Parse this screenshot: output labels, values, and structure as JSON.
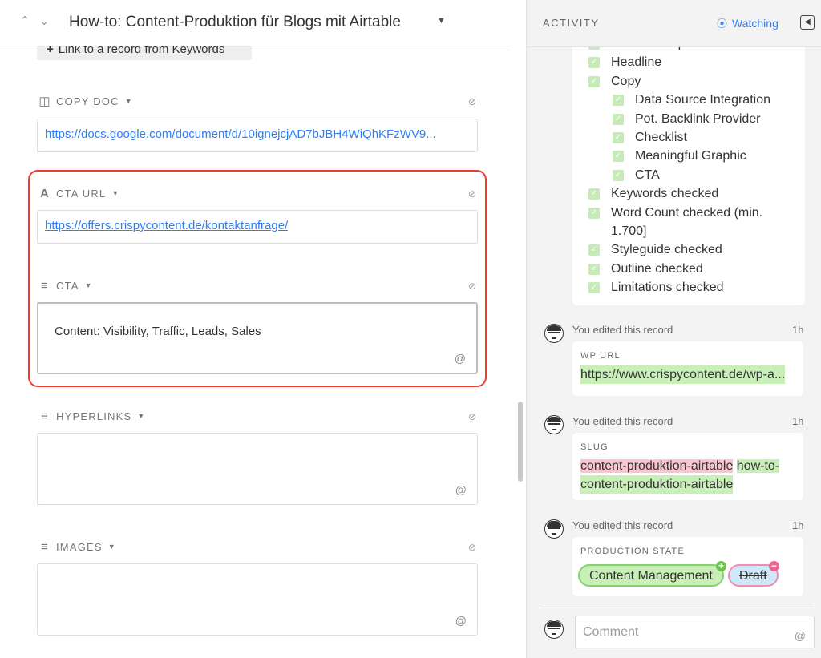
{
  "header": {
    "title": "How-to: Content-Produktion für Blogs mit Airtable",
    "prev_icon": "chevron-up-icon",
    "next_icon": "chevron-down-icon"
  },
  "link_button": {
    "label": "Link to a record from Keywords"
  },
  "fields": {
    "copy_doc": {
      "label": "COPY DOC",
      "value": "https://docs.google.com/document/d/10ignejcjAD7bJBH4WiQhKFzWV9..."
    },
    "cta_url": {
      "label": "CTA URL",
      "value": "https://offers.crispycontent.de/kontaktanfrage/"
    },
    "cta": {
      "label": "CTA",
      "value": "Content: Visibility, Traffic, Leads, Sales"
    },
    "hyperlinks": {
      "label": "HYPERLINKS",
      "value": ""
    },
    "images": {
      "label": "IMAGES",
      "value": ""
    }
  },
  "activity": {
    "title": "ACTIVITY",
    "watching_label": "Watching",
    "checklist": [
      {
        "label": "SEO Description",
        "indent": 0
      },
      {
        "label": "Headline",
        "indent": 0
      },
      {
        "label": "Copy",
        "indent": 0
      },
      {
        "label": "Data Source Integration",
        "indent": 1
      },
      {
        "label": "Pot. Backlink Provider",
        "indent": 1
      },
      {
        "label": "Checklist",
        "indent": 1
      },
      {
        "label": "Meaningful Graphic",
        "indent": 1
      },
      {
        "label": "CTA",
        "indent": 1
      },
      {
        "label": "Keywords checked",
        "indent": 0
      },
      {
        "label": "Word Count checked (min.",
        "indent": 0
      },
      {
        "label": "1.700]",
        "indent": 0,
        "continuation": true
      },
      {
        "label": "Styleguide checked",
        "indent": 0
      },
      {
        "label": "Outline checked",
        "indent": 0
      },
      {
        "label": "Limitations checked",
        "indent": 0
      }
    ],
    "edits": [
      {
        "meta": "You edited this record",
        "time": "1h",
        "field": "WP URL",
        "added": "https://www.crispycontent.de/wp-a..."
      },
      {
        "meta": "You edited this record",
        "time": "1h",
        "field": "SLUG",
        "removed": "content-produktion-airtable",
        "added_line1": "how-to-",
        "added_line2": "content-produktion-airtable"
      },
      {
        "meta": "You edited this record",
        "time": "1h",
        "field": "PRODUCTION STATE",
        "added_pill": "Content Management",
        "removed_pill": "Draft"
      }
    ],
    "comment_placeholder": "Comment"
  },
  "colors": {
    "accent": "#2d7ff9",
    "highlight_border": "#ef3b2c",
    "added_bg": "#c8efb7",
    "removed_bg": "#f9c6d0"
  }
}
